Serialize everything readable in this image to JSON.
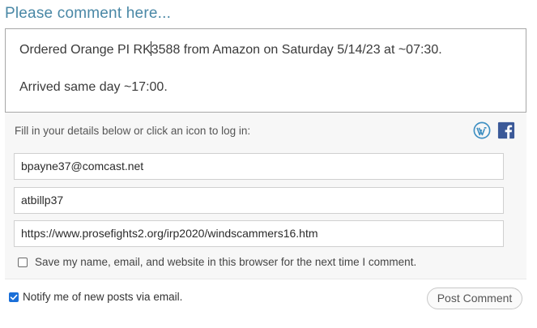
{
  "heading": "Please comment here...",
  "comment": {
    "line1_before_caret": "Ordered Orange PI RK",
    "line1_after_caret": "3588 from Amazon on Saturday 5/14/23 at ~07:30.",
    "line2": "Arrived same day ~17:00."
  },
  "identity": {
    "fill_text": "Fill in your details below or click an icon to log in:",
    "login_icons": [
      "wordpress-icon",
      "facebook-icon"
    ],
    "email_value": "bpayne37@comcast.net",
    "name_value": "atbillp37",
    "website_value": "https://www.prosefights2.org/irp2020/windscammers16.htm",
    "save_label": "Save my name, email, and website in this browser for the next time I comment."
  },
  "notify": {
    "label": "Notify me of new posts via email.",
    "checked": true
  },
  "post_button": "Post Comment",
  "colors": {
    "heading": "#4a88a6",
    "checkbox_on": "#1a6fd8",
    "wordpress": "#3e8fc2",
    "facebook": "#3b5998"
  }
}
